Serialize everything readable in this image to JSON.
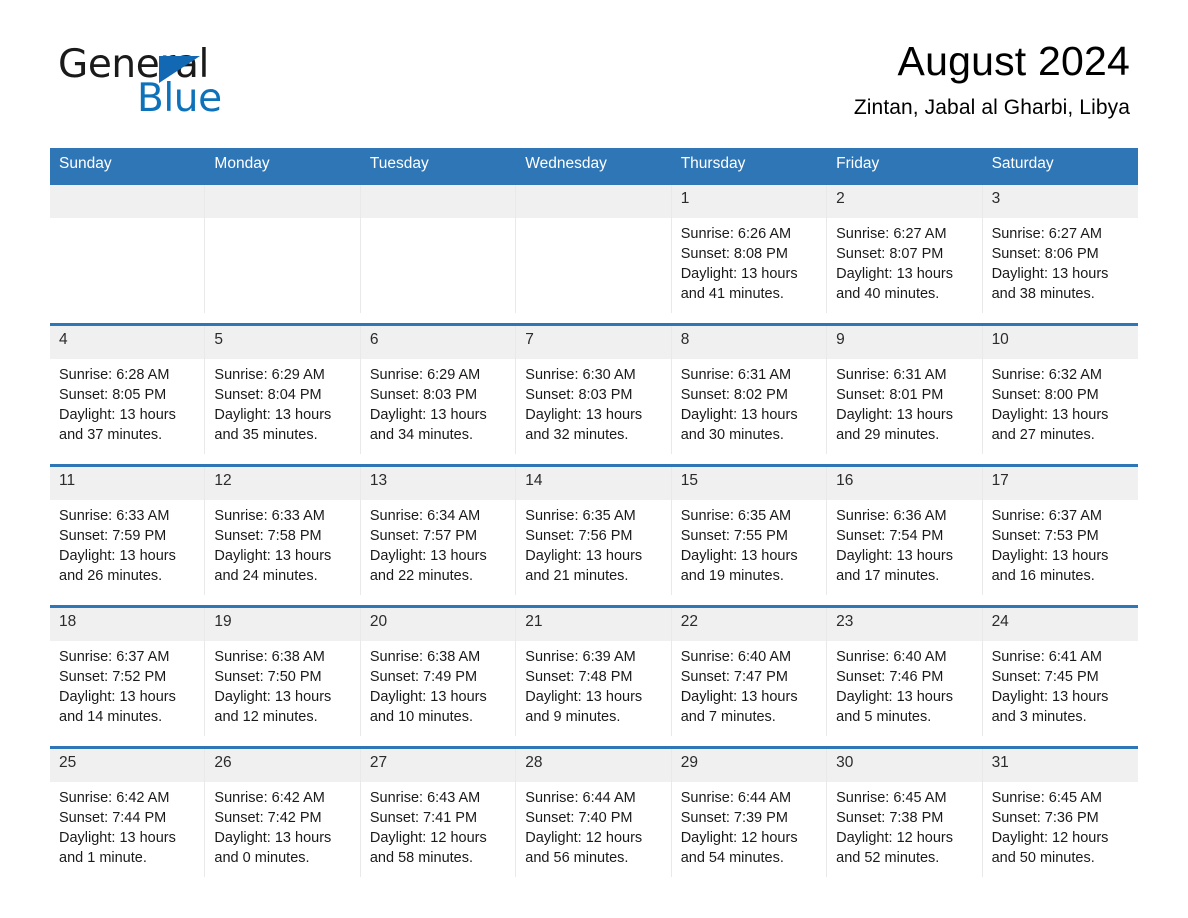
{
  "brand": {
    "name_part1": "General",
    "name_part2": "Blue",
    "triangle_color": "#1268b3",
    "blue_color": "#0d72ba"
  },
  "header": {
    "title": "August 2024",
    "location": "Zintan, Jabal al Gharbi, Libya"
  },
  "theme": {
    "header_blue": "#2e76b6",
    "date_band": "#f0f0f0",
    "cell_bg": "#ffffff"
  },
  "weekdays": [
    "Sunday",
    "Monday",
    "Tuesday",
    "Wednesday",
    "Thursday",
    "Friday",
    "Saturday"
  ],
  "labels": {
    "sunrise": "Sunrise:",
    "sunset": "Sunset:",
    "daylight": "Daylight:"
  },
  "weeks": [
    [
      {
        "day": "",
        "empty": true
      },
      {
        "day": "",
        "empty": true
      },
      {
        "day": "",
        "empty": true
      },
      {
        "day": "",
        "empty": true
      },
      {
        "day": "1",
        "sunrise": "Sunrise: 6:26 AM",
        "sunset": "Sunset: 8:08 PM",
        "daylight": "Daylight: 13 hours and 41 minutes."
      },
      {
        "day": "2",
        "sunrise": "Sunrise: 6:27 AM",
        "sunset": "Sunset: 8:07 PM",
        "daylight": "Daylight: 13 hours and 40 minutes."
      },
      {
        "day": "3",
        "sunrise": "Sunrise: 6:27 AM",
        "sunset": "Sunset: 8:06 PM",
        "daylight": "Daylight: 13 hours and 38 minutes."
      }
    ],
    [
      {
        "day": "4",
        "sunrise": "Sunrise: 6:28 AM",
        "sunset": "Sunset: 8:05 PM",
        "daylight": "Daylight: 13 hours and 37 minutes."
      },
      {
        "day": "5",
        "sunrise": "Sunrise: 6:29 AM",
        "sunset": "Sunset: 8:04 PM",
        "daylight": "Daylight: 13 hours and 35 minutes."
      },
      {
        "day": "6",
        "sunrise": "Sunrise: 6:29 AM",
        "sunset": "Sunset: 8:03 PM",
        "daylight": "Daylight: 13 hours and 34 minutes."
      },
      {
        "day": "7",
        "sunrise": "Sunrise: 6:30 AM",
        "sunset": "Sunset: 8:03 PM",
        "daylight": "Daylight: 13 hours and 32 minutes."
      },
      {
        "day": "8",
        "sunrise": "Sunrise: 6:31 AM",
        "sunset": "Sunset: 8:02 PM",
        "daylight": "Daylight: 13 hours and 30 minutes."
      },
      {
        "day": "9",
        "sunrise": "Sunrise: 6:31 AM",
        "sunset": "Sunset: 8:01 PM",
        "daylight": "Daylight: 13 hours and 29 minutes."
      },
      {
        "day": "10",
        "sunrise": "Sunrise: 6:32 AM",
        "sunset": "Sunset: 8:00 PM",
        "daylight": "Daylight: 13 hours and 27 minutes."
      }
    ],
    [
      {
        "day": "11",
        "sunrise": "Sunrise: 6:33 AM",
        "sunset": "Sunset: 7:59 PM",
        "daylight": "Daylight: 13 hours and 26 minutes."
      },
      {
        "day": "12",
        "sunrise": "Sunrise: 6:33 AM",
        "sunset": "Sunset: 7:58 PM",
        "daylight": "Daylight: 13 hours and 24 minutes."
      },
      {
        "day": "13",
        "sunrise": "Sunrise: 6:34 AM",
        "sunset": "Sunset: 7:57 PM",
        "daylight": "Daylight: 13 hours and 22 minutes."
      },
      {
        "day": "14",
        "sunrise": "Sunrise: 6:35 AM",
        "sunset": "Sunset: 7:56 PM",
        "daylight": "Daylight: 13 hours and 21 minutes."
      },
      {
        "day": "15",
        "sunrise": "Sunrise: 6:35 AM",
        "sunset": "Sunset: 7:55 PM",
        "daylight": "Daylight: 13 hours and 19 minutes."
      },
      {
        "day": "16",
        "sunrise": "Sunrise: 6:36 AM",
        "sunset": "Sunset: 7:54 PM",
        "daylight": "Daylight: 13 hours and 17 minutes."
      },
      {
        "day": "17",
        "sunrise": "Sunrise: 6:37 AM",
        "sunset": "Sunset: 7:53 PM",
        "daylight": "Daylight: 13 hours and 16 minutes."
      }
    ],
    [
      {
        "day": "18",
        "sunrise": "Sunrise: 6:37 AM",
        "sunset": "Sunset: 7:52 PM",
        "daylight": "Daylight: 13 hours and 14 minutes."
      },
      {
        "day": "19",
        "sunrise": "Sunrise: 6:38 AM",
        "sunset": "Sunset: 7:50 PM",
        "daylight": "Daylight: 13 hours and 12 minutes."
      },
      {
        "day": "20",
        "sunrise": "Sunrise: 6:38 AM",
        "sunset": "Sunset: 7:49 PM",
        "daylight": "Daylight: 13 hours and 10 minutes."
      },
      {
        "day": "21",
        "sunrise": "Sunrise: 6:39 AM",
        "sunset": "Sunset: 7:48 PM",
        "daylight": "Daylight: 13 hours and 9 minutes."
      },
      {
        "day": "22",
        "sunrise": "Sunrise: 6:40 AM",
        "sunset": "Sunset: 7:47 PM",
        "daylight": "Daylight: 13 hours and 7 minutes."
      },
      {
        "day": "23",
        "sunrise": "Sunrise: 6:40 AM",
        "sunset": "Sunset: 7:46 PM",
        "daylight": "Daylight: 13 hours and 5 minutes."
      },
      {
        "day": "24",
        "sunrise": "Sunrise: 6:41 AM",
        "sunset": "Sunset: 7:45 PM",
        "daylight": "Daylight: 13 hours and 3 minutes."
      }
    ],
    [
      {
        "day": "25",
        "sunrise": "Sunrise: 6:42 AM",
        "sunset": "Sunset: 7:44 PM",
        "daylight": "Daylight: 13 hours and 1 minute."
      },
      {
        "day": "26",
        "sunrise": "Sunrise: 6:42 AM",
        "sunset": "Sunset: 7:42 PM",
        "daylight": "Daylight: 13 hours and 0 minutes."
      },
      {
        "day": "27",
        "sunrise": "Sunrise: 6:43 AM",
        "sunset": "Sunset: 7:41 PM",
        "daylight": "Daylight: 12 hours and 58 minutes."
      },
      {
        "day": "28",
        "sunrise": "Sunrise: 6:44 AM",
        "sunset": "Sunset: 7:40 PM",
        "daylight": "Daylight: 12 hours and 56 minutes."
      },
      {
        "day": "29",
        "sunrise": "Sunrise: 6:44 AM",
        "sunset": "Sunset: 7:39 PM",
        "daylight": "Daylight: 12 hours and 54 minutes."
      },
      {
        "day": "30",
        "sunrise": "Sunrise: 6:45 AM",
        "sunset": "Sunset: 7:38 PM",
        "daylight": "Daylight: 12 hours and 52 minutes."
      },
      {
        "day": "31",
        "sunrise": "Sunrise: 6:45 AM",
        "sunset": "Sunset: 7:36 PM",
        "daylight": "Daylight: 12 hours and 50 minutes."
      }
    ]
  ]
}
